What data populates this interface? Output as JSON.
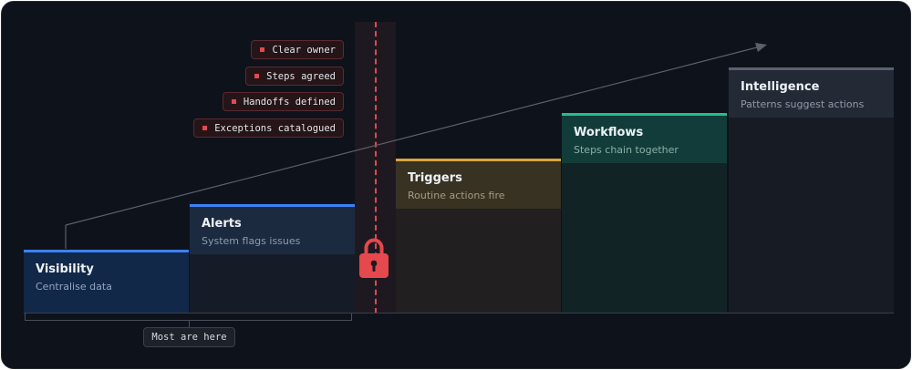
{
  "steps": [
    {
      "title": "Visibility",
      "subtitle": "Centralise data"
    },
    {
      "title": "Alerts",
      "subtitle": "System flags issues"
    },
    {
      "title": "Triggers",
      "subtitle": "Routine actions fire"
    },
    {
      "title": "Workflows",
      "subtitle": "Steps chain together"
    },
    {
      "title": "Intelligence",
      "subtitle": "Patterns suggest actions"
    }
  ],
  "requirements": [
    "Clear owner",
    "Steps agreed",
    "Handoffs defined",
    "Exceptions catalogued"
  ],
  "bracket_label": "Most are here",
  "icons": {
    "lock": "lock-icon",
    "arrow": "trend-arrow"
  },
  "colors": {
    "background": "#0e121a",
    "blue": "#3b82f6",
    "amber": "#d9a441",
    "green": "#22c08a",
    "gray": "#5a6170",
    "red": "#e5484d"
  }
}
